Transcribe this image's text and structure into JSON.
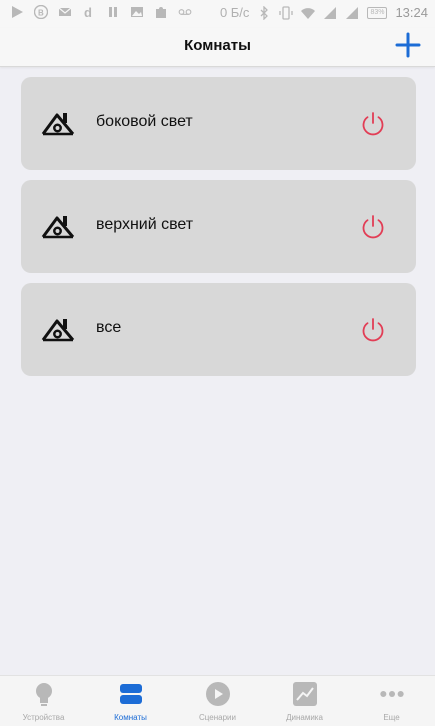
{
  "status_bar": {
    "net_speed": "0 Б/с",
    "battery": "83%",
    "time": "13:24"
  },
  "header": {
    "title": "Комнаты"
  },
  "rooms": [
    {
      "name": "боковой свет"
    },
    {
      "name": "верхний свет"
    },
    {
      "name": "все"
    }
  ],
  "tabs": [
    {
      "label": "Устройства",
      "icon": "lightbulb-icon"
    },
    {
      "label": "Комнаты",
      "icon": "rooms-icon"
    },
    {
      "label": "Сценарии",
      "icon": "play-icon"
    },
    {
      "label": "Динамика",
      "icon": "chart-icon"
    },
    {
      "label": "Еще",
      "icon": "more-icon"
    }
  ],
  "colors": {
    "accent": "#1c6cd6",
    "power": "#e23d55",
    "card_bg": "#d8d8d8",
    "page_bg": "#efeff4"
  }
}
